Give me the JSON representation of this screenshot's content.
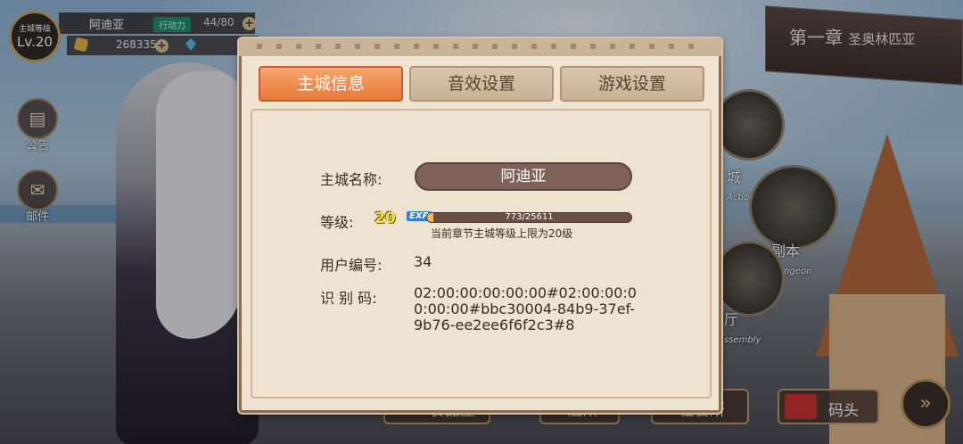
{
  "status": {
    "lv_label": "主城等级",
    "lv_value": "Lv.20",
    "player_name": "阿迪亚",
    "stamina_label": "行动力",
    "stamina_value": "44/80",
    "gold": "268335"
  },
  "side_buttons": [
    {
      "label": "公告",
      "icon": "announcement-icon"
    },
    {
      "label": "邮件",
      "icon": "mail-icon"
    }
  ],
  "chapter": {
    "title": "第一章",
    "subtitle": "圣奥林匹亚"
  },
  "buildings": [
    {
      "label": "城",
      "sub": "Action"
    },
    {
      "label": "副本",
      "sub": "Dungeon"
    },
    {
      "label": "厅",
      "sub": "ssembly"
    }
  ],
  "bottom_buttons": [
    {
      "label": "餐品屋"
    },
    {
      "label": "店所"
    },
    {
      "label": "征召所"
    },
    {
      "label": "码头"
    }
  ],
  "panel": {
    "tabs": [
      {
        "label": "主城信息",
        "active": true
      },
      {
        "label": "音效设置",
        "active": false
      },
      {
        "label": "游戏设置",
        "active": false
      }
    ],
    "city_name_label": "主城名称:",
    "city_name": "阿迪亚",
    "level_label": "等级:",
    "level": "20",
    "exp_badge": "EXP",
    "exp_text": "773/25611",
    "exp_progress": 0.0302,
    "level_hint": "当前章节主城等级上限为20级",
    "user_id_label": "用户编号:",
    "user_id": "34",
    "id_code_label": "识 别 码:",
    "id_code": "02:00:00:00:00:00#02:00:00:00:00:00#bbc30004-84b9-37ef-9b76-ee2ee6f6f2c3#8"
  },
  "colors": {
    "tab_active": "#e9793a",
    "panel_bg": "#efe4d2",
    "level_yellow": "#f5e23a"
  }
}
